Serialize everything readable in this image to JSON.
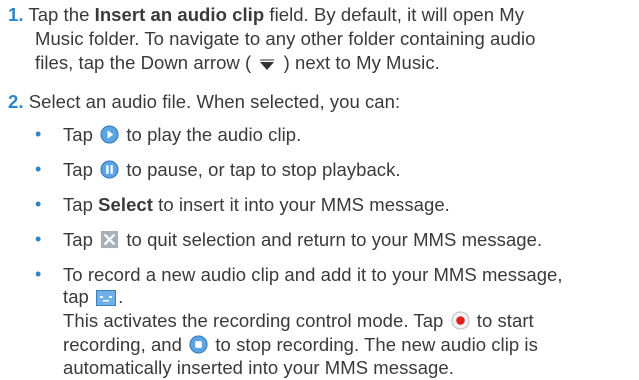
{
  "step1": {
    "number": "1.",
    "pre": "Tap the ",
    "bold": "Insert an audio clip",
    "post": " field. By default, it will open My",
    "line2": "Music folder. To navigate to any other folder containing audio",
    "line3_pre": "files, tap the Down arrow ( ",
    "line3_post": " ) next to My Music."
  },
  "step2": {
    "number": "2.",
    "text": "Select an audio file. When selected, you can:"
  },
  "bullets": {
    "b1": {
      "pre": "Tap ",
      "post": " to play the audio clip."
    },
    "b2": {
      "pre": "Tap ",
      "post": " to pause, or tap  to stop playback."
    },
    "b3": {
      "pre": "Tap ",
      "bold": "Select",
      "post": " to insert it into your MMS message."
    },
    "b4": {
      "pre": "Tap ",
      "post": " to quit selection and return to your MMS message."
    },
    "b5": {
      "line1": "To record a new audio clip and add it to your MMS message,",
      "line2_pre": "tap ",
      "line2_post": ".",
      "line3_pre": "This activates the recording control mode. Tap ",
      "line3_post": " to start",
      "line4_pre": "recording, and ",
      "line4_post": " to stop recording. The new audio clip is",
      "line5": "automatically inserted into your MMS message."
    }
  },
  "bullet_char": "•",
  "icons": {
    "down_arrow": "down-arrow-icon",
    "play": "play-icon",
    "pause": "pause-icon",
    "close": "close-x-icon",
    "record_tool": "record-tool-icon",
    "record": "record-icon",
    "stop": "stop-icon"
  },
  "colors": {
    "accent": "#2a86c9",
    "text": "#3a3a3a"
  }
}
